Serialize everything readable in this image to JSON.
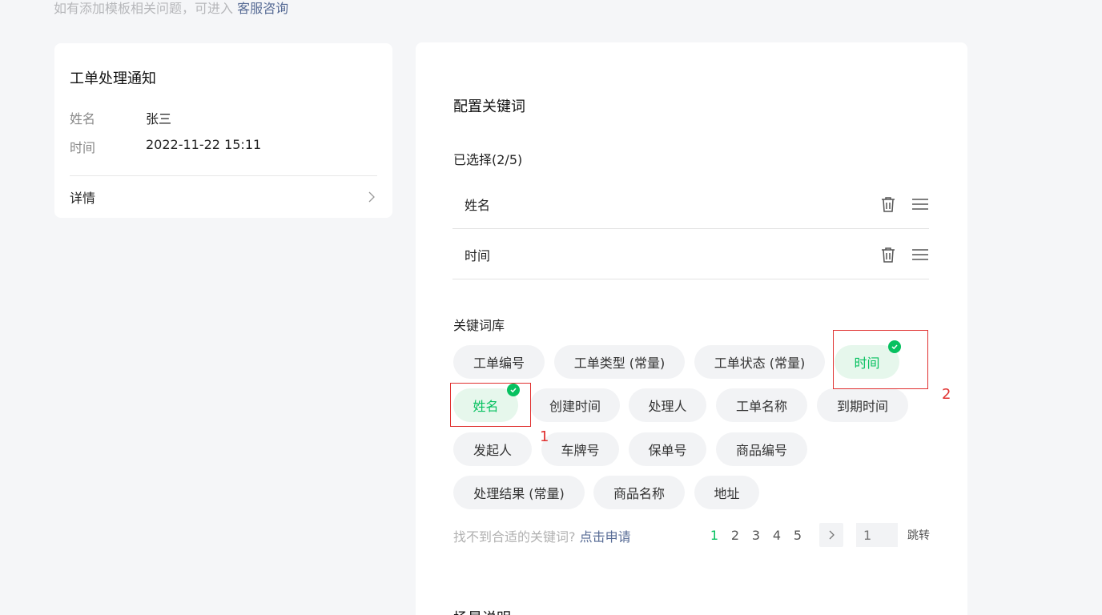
{
  "hint": {
    "text": "如有添加模板相关问题，可进入 ",
    "link": "客服咨询"
  },
  "preview": {
    "title": "工单处理通知",
    "rows": [
      {
        "key": "姓名",
        "value": "张三"
      },
      {
        "key": "时间",
        "value": "2022-11-22 15:11"
      }
    ],
    "detail_label": "详情"
  },
  "config": {
    "title": "配置关键词",
    "selected_label": "已选择(2/5)",
    "selected": [
      "姓名",
      "时间"
    ],
    "library_title": "关键词库",
    "chips": [
      {
        "label": "工单编号",
        "active": false
      },
      {
        "label": "工单类型 (常量)",
        "active": false
      },
      {
        "label": "工单状态 (常量)",
        "active": false
      },
      {
        "label": "时间",
        "active": true
      },
      {
        "label": "姓名",
        "active": true
      },
      {
        "label": "创建时间",
        "active": false
      },
      {
        "label": "处理人",
        "active": false
      },
      {
        "label": "工单名称",
        "active": false
      },
      {
        "label": "到期时间",
        "active": false
      },
      {
        "label": "发起人",
        "active": false
      },
      {
        "label": "车牌号",
        "active": false
      },
      {
        "label": "保单号",
        "active": false
      },
      {
        "label": "商品编号",
        "active": false
      },
      {
        "label": "处理结果 (常量)",
        "active": false
      },
      {
        "label": "商品名称",
        "active": false
      },
      {
        "label": "地址",
        "active": false
      }
    ],
    "notfound_text": "找不到合适的关键词? ",
    "notfound_link": "点击申请",
    "pages": [
      "1",
      "2",
      "3",
      "4",
      "5"
    ],
    "current_page": "1",
    "jump_placeholder": "1",
    "jump_label": "跳转",
    "scene_title": "场景说明"
  },
  "annotations": {
    "label_1": "1",
    "label_2": "2"
  },
  "colors": {
    "accent": "#07c160",
    "link": "#576b95",
    "annotation": "#e0302f"
  }
}
